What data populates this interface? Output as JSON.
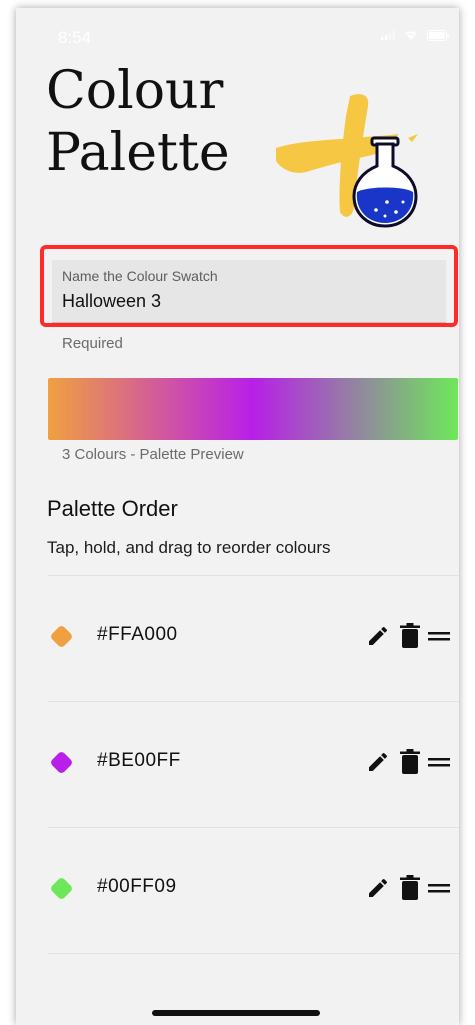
{
  "status_bar": {
    "time": "8:54"
  },
  "title": {
    "line1": "Colour",
    "line2": "Palette"
  },
  "name_field": {
    "label": "Name the Colour Swatch",
    "value": "Halloween 3",
    "helper": "Required"
  },
  "preview": {
    "caption": "3 Colours - Palette Preview"
  },
  "palette_order": {
    "title": "Palette Order",
    "subtitle": "Tap, hold, and drag to reorder colours",
    "colors": [
      {
        "hex": "#FFA000",
        "display": "#FFA000",
        "swatch": "#f0a040"
      },
      {
        "hex": "#BE00FF",
        "display": "#BE00FF",
        "swatch": "#b81fe8"
      },
      {
        "hex": "#00FF09",
        "display": "#00FF09",
        "swatch": "#6ee85a"
      }
    ]
  },
  "icons": {
    "edit": "pencil-icon",
    "delete": "trash-icon",
    "drag": "drag-handle-icon"
  },
  "colors": {
    "highlight": "#ff2a2a",
    "background": "#f2f2f2",
    "logo_yellow": "#f5c742",
    "logo_flask_blue": "#1a36c8"
  }
}
